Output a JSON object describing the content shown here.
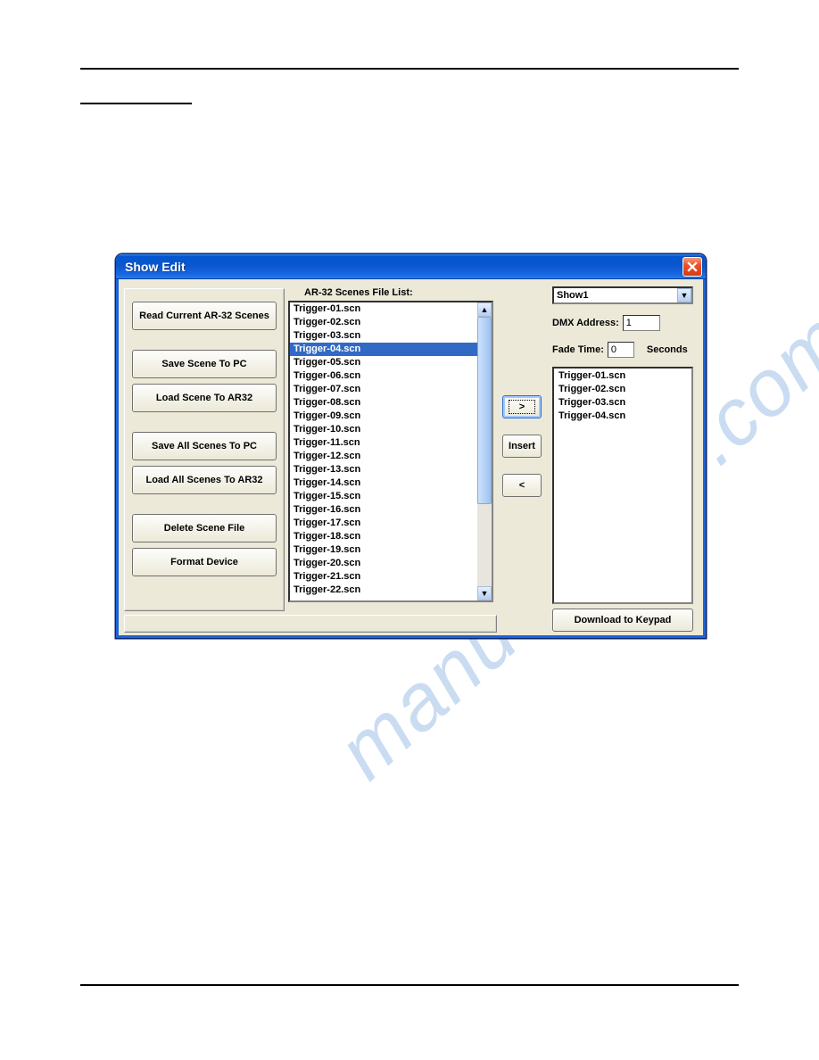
{
  "window": {
    "title": "Show Edit"
  },
  "sidebar": {
    "buttons": {
      "read": "Read Current AR-32 Scenes",
      "save_scene": "Save Scene To PC",
      "load_scene": "Load Scene To AR32",
      "save_all": "Save All Scenes To PC",
      "load_all": "Load All Scenes To AR32",
      "delete": "Delete Scene File",
      "format": "Format Device"
    }
  },
  "scene_list": {
    "header": "AR-32 Scenes File List:",
    "selected_index": 3,
    "items": [
      "Trigger-01.scn",
      "Trigger-02.scn",
      "Trigger-03.scn",
      "Trigger-04.scn",
      "Trigger-05.scn",
      "Trigger-06.scn",
      "Trigger-07.scn",
      "Trigger-08.scn",
      "Trigger-09.scn",
      "Trigger-10.scn",
      "Trigger-11.scn",
      "Trigger-12.scn",
      "Trigger-13.scn",
      "Trigger-14.scn",
      "Trigger-15.scn",
      "Trigger-16.scn",
      "Trigger-17.scn",
      "Trigger-18.scn",
      "Trigger-19.scn",
      "Trigger-20.scn",
      "Trigger-21.scn",
      "Trigger-22.scn"
    ]
  },
  "mid": {
    "add": ">",
    "insert": "Insert",
    "remove": "<"
  },
  "right": {
    "show_selected": "Show1",
    "dmx_label": "DMX Address:",
    "dmx_value": "1",
    "fade_label": "Fade Time:",
    "fade_value": "0",
    "seconds": "Seconds",
    "items": [
      "Trigger-01.scn",
      "Trigger-02.scn",
      "Trigger-03.scn",
      "Trigger-04.scn"
    ],
    "download": "Download to Keypad"
  },
  "watermark": "manualshive.com"
}
